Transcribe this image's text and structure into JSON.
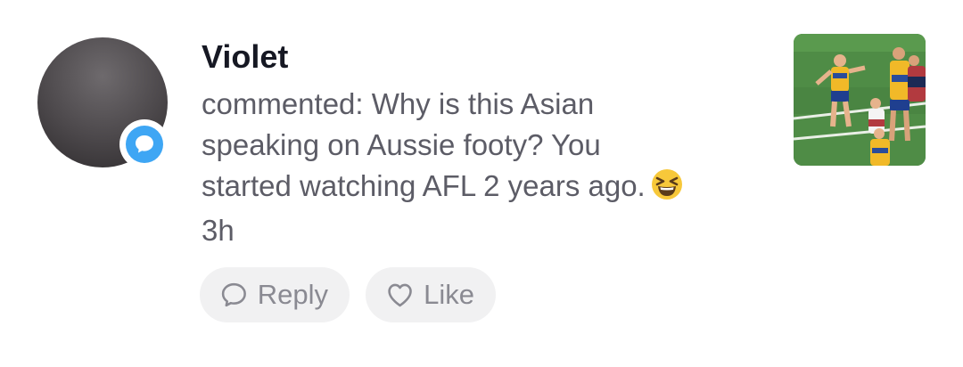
{
  "comment": {
    "username": "Violet",
    "lines": [
      "commented: Why is this Asian",
      "speaking on Aussie footy? You",
      "started watching AFL 2 years ago."
    ],
    "emoji": "grinning-squinting-face",
    "time": "3h"
  },
  "actions": {
    "reply_label": "Reply",
    "like_label": "Like"
  },
  "badge": {
    "icon": "comment-bubble-icon",
    "color": "#3ea6f4"
  },
  "colors": {
    "username": "#161823",
    "body_text": "#5c5c66",
    "pill_bg": "#f1f1f2",
    "pill_text": "#8a8a92"
  }
}
